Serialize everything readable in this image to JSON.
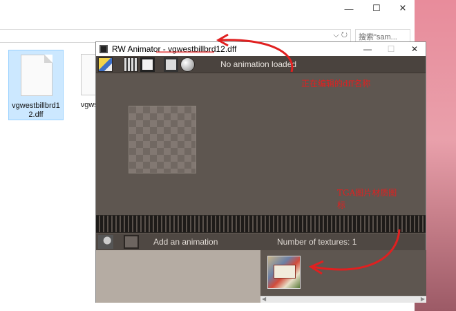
{
  "explorer": {
    "minimize_glyph": "—",
    "maximize_glyph": "☐",
    "close_glyph": "✕",
    "address_buttons": "⌵  ↻",
    "search_placeholder": "搜索\"sam...",
    "files": [
      {
        "name": "vgwestbillbrd12.dff",
        "selected": true
      },
      {
        "name": "vgwstbbd",
        "selected": false
      }
    ]
  },
  "rw_animator": {
    "title": "RW Animator - vgwestbillbrd12.dff",
    "window_buttons": {
      "minimize": "—",
      "maximize": "☐",
      "close": "✕"
    },
    "toolbar": {
      "status": "No animation loaded",
      "icons": [
        "open-file-icon",
        "film-icon",
        "texture-icon",
        "monitor-icon",
        "sphere-icon"
      ]
    },
    "animbar": {
      "add_label": "Add an animation",
      "texture_count_label": "Number of textures: 1",
      "icons": [
        "clapper-star-icon",
        "trash-bin-icon"
      ]
    },
    "textures": [
      {
        "icon": "tga-texture-thumbnail"
      }
    ]
  },
  "annotations": {
    "title_note": "正在编辑的dff名称",
    "texture_note_line1": "TGA图片材质图",
    "texture_note_line2": "标",
    "color": "#e02020"
  }
}
